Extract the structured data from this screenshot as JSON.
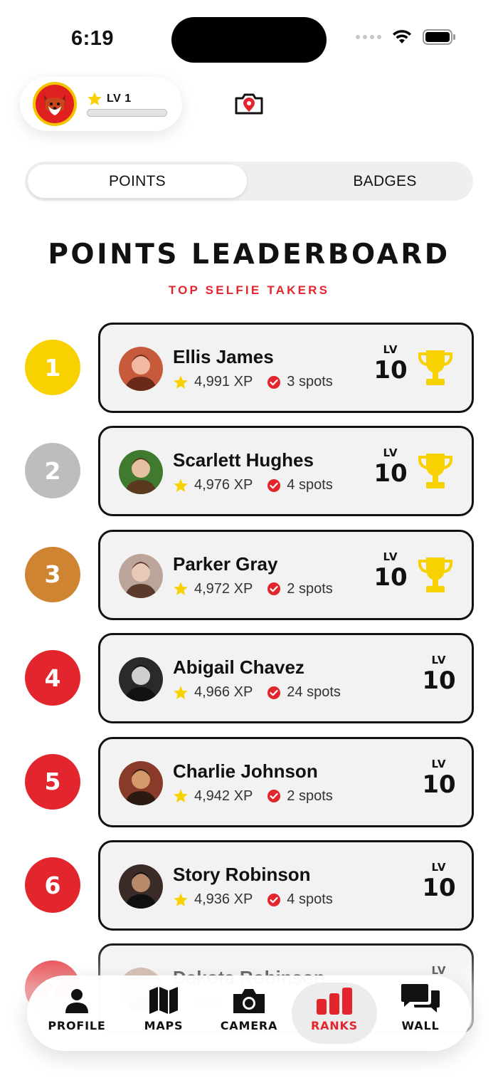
{
  "status_bar": {
    "time": "6:19"
  },
  "header": {
    "level_label": "LV 1",
    "xp_progress": 0
  },
  "segments": [
    {
      "label": "POINTS",
      "active": true
    },
    {
      "label": "BADGES",
      "active": false
    }
  ],
  "leaderboard": {
    "title": "POINTS LEADERBOARD",
    "subtitle": "TOP SELFIE TAKERS",
    "lv_label": "LV",
    "entries": [
      {
        "rank": "1",
        "name": "Ellis James",
        "xp": "4,991 XP",
        "spots": "3 spots",
        "level": "10",
        "trophy": true,
        "rank_color": "#f7d100"
      },
      {
        "rank": "2",
        "name": "Scarlett Hughes",
        "xp": "4,976 XP",
        "spots": "4 spots",
        "level": "10",
        "trophy": true,
        "rank_color": "#bdbdbd"
      },
      {
        "rank": "3",
        "name": "Parker Gray",
        "xp": "4,972 XP",
        "spots": "2 spots",
        "level": "10",
        "trophy": true,
        "rank_color": "#cf8432"
      },
      {
        "rank": "4",
        "name": "Abigail Chavez",
        "xp": "4,966 XP",
        "spots": "24 spots",
        "level": "10",
        "trophy": false,
        "rank_color": "#e3262d"
      },
      {
        "rank": "5",
        "name": "Charlie Johnson",
        "xp": "4,942 XP",
        "spots": "2 spots",
        "level": "10",
        "trophy": false,
        "rank_color": "#e3262d"
      },
      {
        "rank": "6",
        "name": "Story Robinson",
        "xp": "4,936 XP",
        "spots": "4 spots",
        "level": "10",
        "trophy": false,
        "rank_color": "#e3262d"
      },
      {
        "rank": "7",
        "name": "Dakota Robinson",
        "xp": "4,92",
        "spots": "",
        "level": "",
        "trophy": false,
        "rank_color": "#e3262d"
      }
    ]
  },
  "tabbar": {
    "tabs": [
      {
        "label": "PROFILE",
        "icon": "person-icon",
        "active": false
      },
      {
        "label": "MAPS",
        "icon": "map-icon",
        "active": false
      },
      {
        "label": "CAMERA",
        "icon": "camera-icon",
        "active": false
      },
      {
        "label": "RANKS",
        "icon": "bar-chart-icon",
        "active": true
      },
      {
        "label": "WALL",
        "icon": "chat-bubbles-icon",
        "active": false
      }
    ]
  },
  "colors": {
    "accent_red": "#e3262d",
    "gold": "#f7d100",
    "silver": "#bdbdbd",
    "bronze": "#cf8432"
  }
}
